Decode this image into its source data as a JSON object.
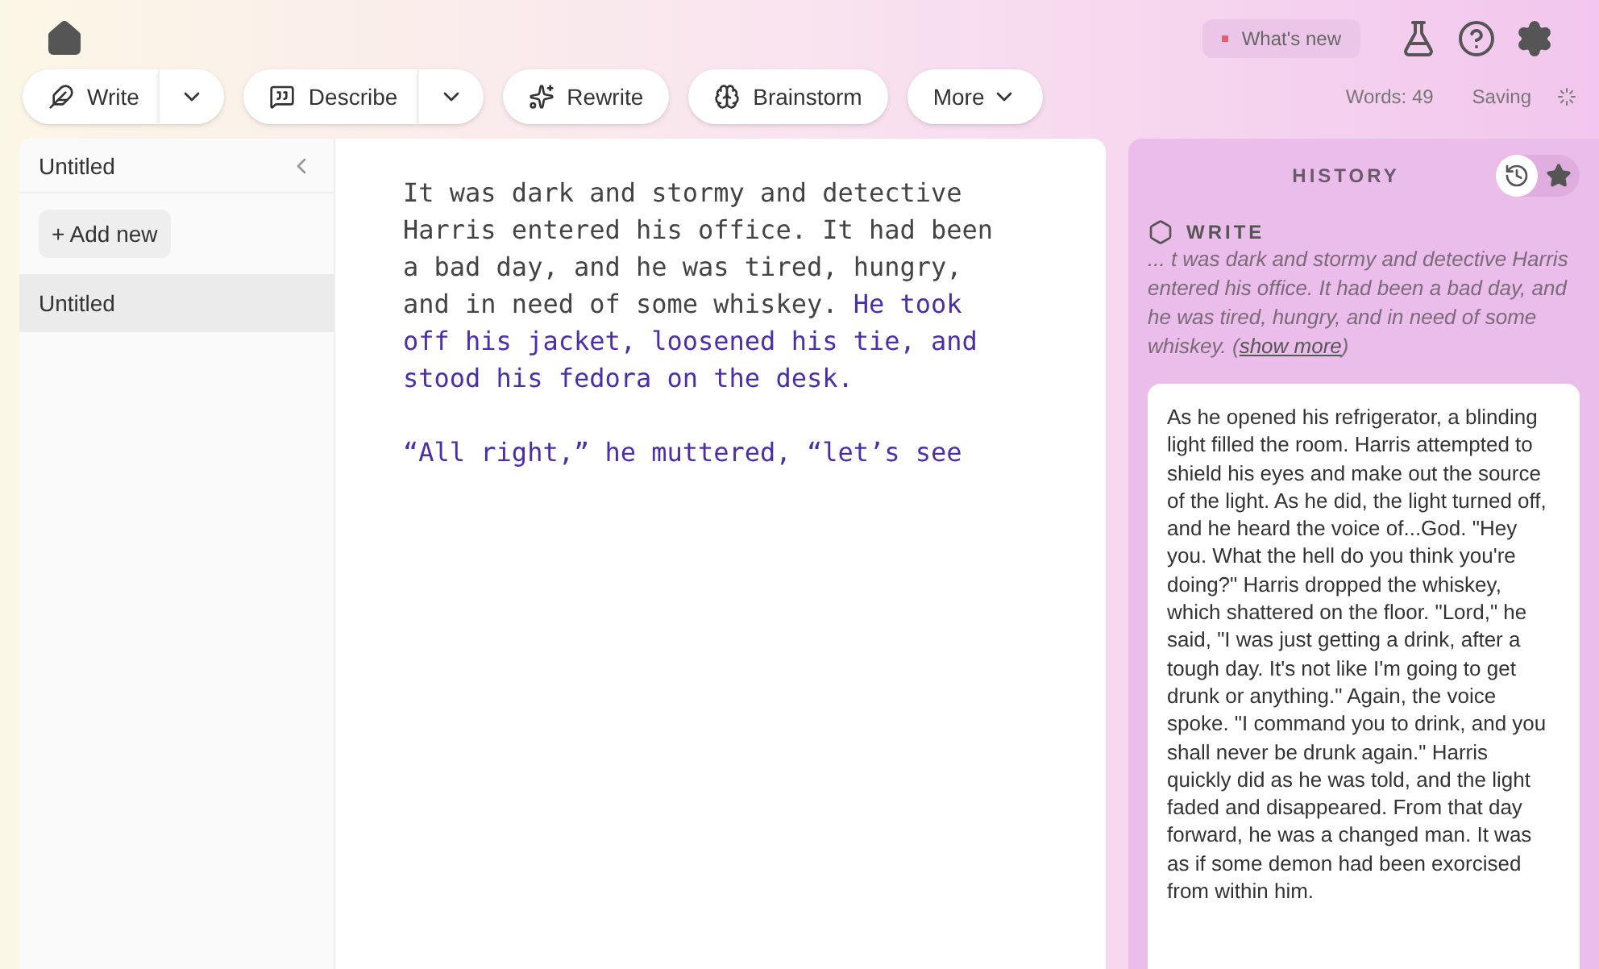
{
  "header": {
    "whats_new": "What's new",
    "words": "Words: 49",
    "status": "Saving"
  },
  "toolbar": [
    {
      "label": "Write",
      "kind": "quill",
      "split_menu": true
    },
    {
      "label": "Describe",
      "kind": "describe",
      "split_menu": true
    },
    {
      "label": "Rewrite",
      "kind": "rewrite",
      "split_menu": false
    },
    {
      "label": "Brainstorm",
      "kind": "brain",
      "split_menu": false
    },
    {
      "label": "More",
      "kind": "menu"
    }
  ],
  "sidebar": {
    "title": "Untitled",
    "add_button": "+ Add new",
    "documents": [
      {
        "title": "Untitled",
        "selected": true
      }
    ]
  },
  "editor": {
    "paragraphs": [
      [
        {
          "kind": "plain",
          "text": "It was dark and stormy and detective Harris entered his office. It had been a bad day, and he was tired, hungry, and in need of some whiskey. "
        },
        {
          "kind": "suggested",
          "text": "He took off his jacket, loosened his tie, and stood his fedora on the desk."
        }
      ],
      [
        {
          "kind": "suggested",
          "text": "“All right,” he muttered, “let’s see"
        }
      ]
    ]
  },
  "history": {
    "title": "HISTORY",
    "tabs": [
      {
        "kind": "clock",
        "selected": true
      },
      {
        "kind": "star",
        "selected": false
      }
    ],
    "entry": {
      "label": "WRITE",
      "excerpt": "... t was dark and stormy and detective Harris entered his office. It had been a bad day, and he was tired, hungry, and in need of some whiskey. (",
      "link": "show more",
      "excerpt_end": ")"
    },
    "card": "As he opened his refrigerator, a blinding light filled the room. Harris attempted to shield his eyes and make out the source of the light. As he did, the light turned off, and he heard the voice of...God. \"Hey you. What the hell do you think you're doing?\" Harris dropped the whiskey, which shattered on the floor. \"Lord,\" he said, \"I was just getting a drink, after a tough day. It's not like I'm going to get drunk or anything.\" Again, the voice spoke. \"I command you to drink, and you shall never be drunk again.\" Harris quickly did as he was told, and the light faded and disappeared. From that day forward, he was a changed man. It was as if some demon had been exorcised from within him."
  }
}
